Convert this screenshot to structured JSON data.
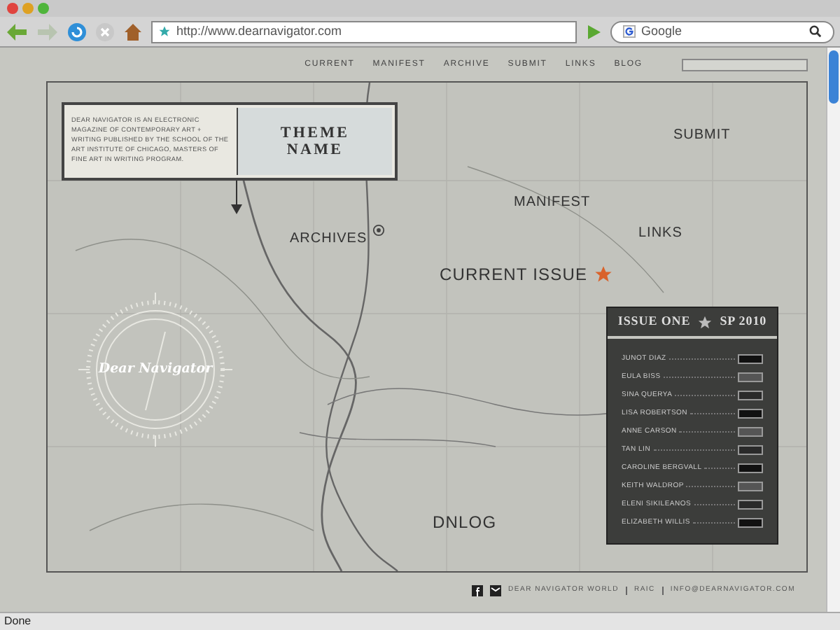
{
  "browser": {
    "url": "http://www.dearnavigator.com",
    "search_placeholder": "Google",
    "status": "Done"
  },
  "nav": [
    "CURRENT",
    "MANIFEST",
    "ARCHIVE",
    "SUBMIT",
    "LINKS",
    "BLOG"
  ],
  "intro": {
    "text": "DEAR NAVIGATOR IS AN ELECTRONIC MAGAZINE OF CONTEMPORARY ART + WRITING PUBLISHED BY THE SCHOOL OF THE ART INSTITUTE OF CHICAGO, MASTERS OF FINE ART IN WRITING PROGRAM.",
    "theme": "THEME NAME"
  },
  "map_labels": [
    {
      "kind": "plain",
      "label": "SUBMIT"
    },
    {
      "kind": "plain",
      "label": "MANIFEST"
    },
    {
      "kind": "plain",
      "label": "LINKS"
    },
    {
      "kind": "target",
      "label": "ARCHIVES"
    },
    {
      "kind": "star",
      "label": "CURRENT ISSUE"
    },
    {
      "kind": "plain",
      "label": "DNLOG"
    }
  ],
  "logo": "Dear Navigator",
  "issue": {
    "title": "ISSUE ONE",
    "season": "SP 2010",
    "contributors": [
      "JUNOT DIAZ",
      "EULA BISS",
      "SINA QUERYA",
      "LISA ROBERTSON",
      "ANNE CARSON",
      "TAN LIN",
      "CAROLINE BERGVALL",
      "KEITH WALDROP",
      "ELENI SIKILEANOS",
      "ELIZABETH WILLIS"
    ]
  },
  "footer": [
    "DEAR NAVIGATOR WORLD",
    "RAIC",
    "INFO@DEARNAVIGATOR.COM"
  ]
}
